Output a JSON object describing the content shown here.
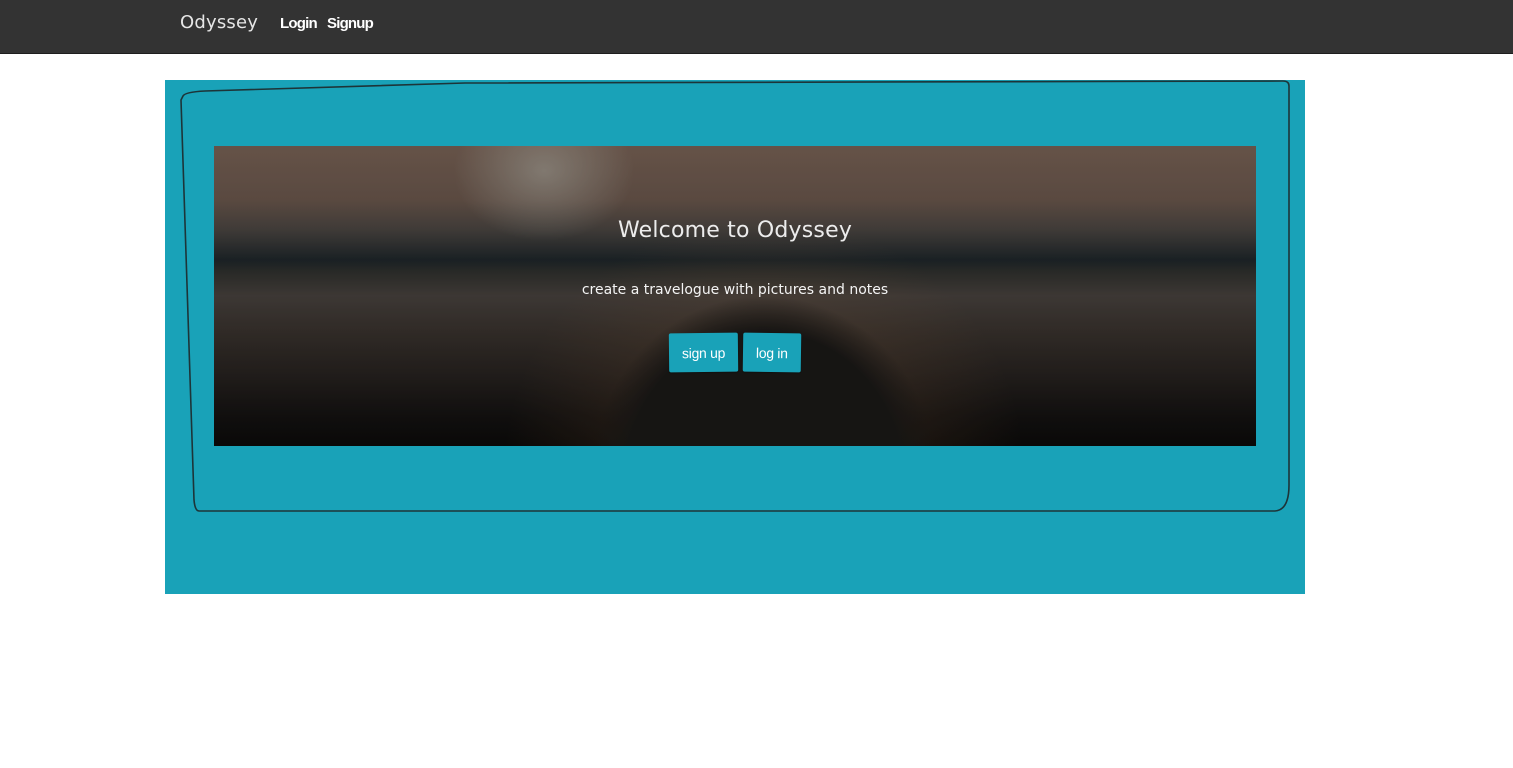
{
  "navbar": {
    "brand": "Odyssey",
    "links": [
      {
        "label": "Login"
      },
      {
        "label": "Signup"
      }
    ]
  },
  "hero": {
    "title": "Welcome to Odyssey",
    "subtitle": "create a travelogue with pictures and notes",
    "buttons": [
      {
        "label": "sign up"
      },
      {
        "label": "log in"
      }
    ]
  },
  "colors": {
    "navbar_bg": "#333333",
    "accent": "#19a2b8",
    "text_light": "#ececec"
  }
}
